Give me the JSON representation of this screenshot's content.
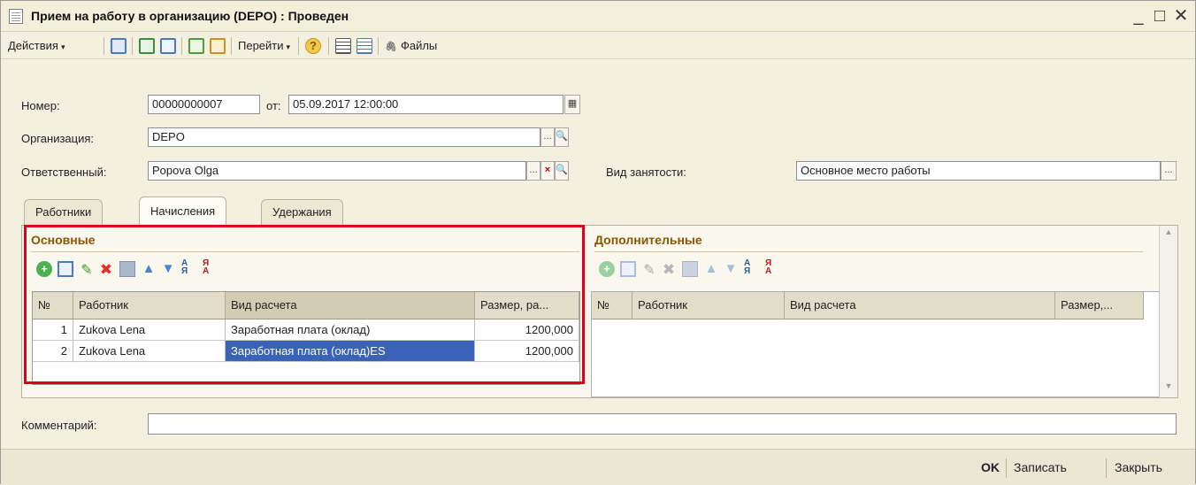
{
  "window": {
    "title": "Прием на работу в организацию (DEPO) : Проведен",
    "minimize_glyph": "_",
    "maximize_glyph": "□",
    "close_glyph": "✕"
  },
  "toolbar": {
    "actions_label": "Действия",
    "goto_label": "Перейти",
    "files_label": "Файлы",
    "dropdown_glyph": "▾",
    "help_glyph": "?",
    "paperclip_glyph": "🖇"
  },
  "form": {
    "number_label": "Номер:",
    "number_value": "00000000007",
    "date_label": "от:",
    "date_value": "05.09.2017 12:00:00",
    "org_label": "Организация:",
    "org_value": "DEPO",
    "resp_label": "Ответственный:",
    "resp_value": "Popova Olga",
    "employment_label": "Вид занятости:",
    "employment_value": "Основное место работы",
    "select_glyph": "...",
    "clear_glyph": "×",
    "search_glyph": "🔍",
    "calendar_glyph": "▦"
  },
  "tabs": [
    {
      "label": "Работники"
    },
    {
      "label": "Начисления"
    },
    {
      "label": "Удержания"
    }
  ],
  "main_section": {
    "title": "Основные",
    "columns": [
      "№",
      "Работник",
      "Вид расчета",
      "Размер, ра..."
    ],
    "rows": [
      {
        "n": "1",
        "employee": "Zukova Lena",
        "type": "Заработная плата (оклад)",
        "amount": "1200,000"
      },
      {
        "n": "2",
        "employee": "Zukova Lena",
        "type": "Заработная плата (оклад)ES",
        "amount": "1200,000"
      }
    ]
  },
  "extra_section": {
    "title": "Дополнительные",
    "columns": [
      "№",
      "Работник",
      "Вид расчета",
      "Размер,..."
    ]
  },
  "comment": {
    "label": "Комментарий:",
    "value": ""
  },
  "bottom": {
    "ok_label": "OK",
    "save_label": "Записать",
    "close_label": "Закрыть"
  },
  "colors": {
    "accent_selection": "#3a63b8",
    "section_title": "#8a5600",
    "highlight_box": "#e0001a"
  }
}
